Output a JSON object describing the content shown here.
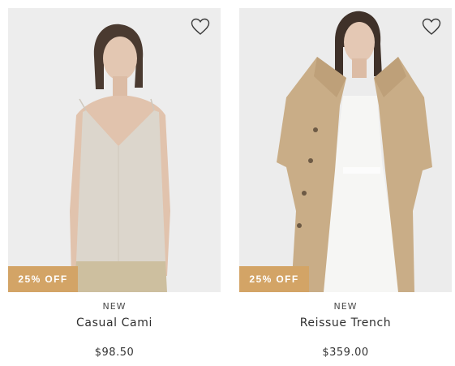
{
  "products": [
    {
      "badge": "25% OFF",
      "tag": "NEW",
      "name": "Casual Cami",
      "price": "$98.50",
      "wishlist_icon": "heart-outline-icon"
    },
    {
      "badge": "25% OFF",
      "tag": "NEW",
      "name": "Reissue Trench",
      "price": "$359.00",
      "wishlist_icon": "heart-outline-icon"
    }
  ],
  "colors": {
    "badge_bg": "#d3a466",
    "image_bg": "#ececec"
  }
}
